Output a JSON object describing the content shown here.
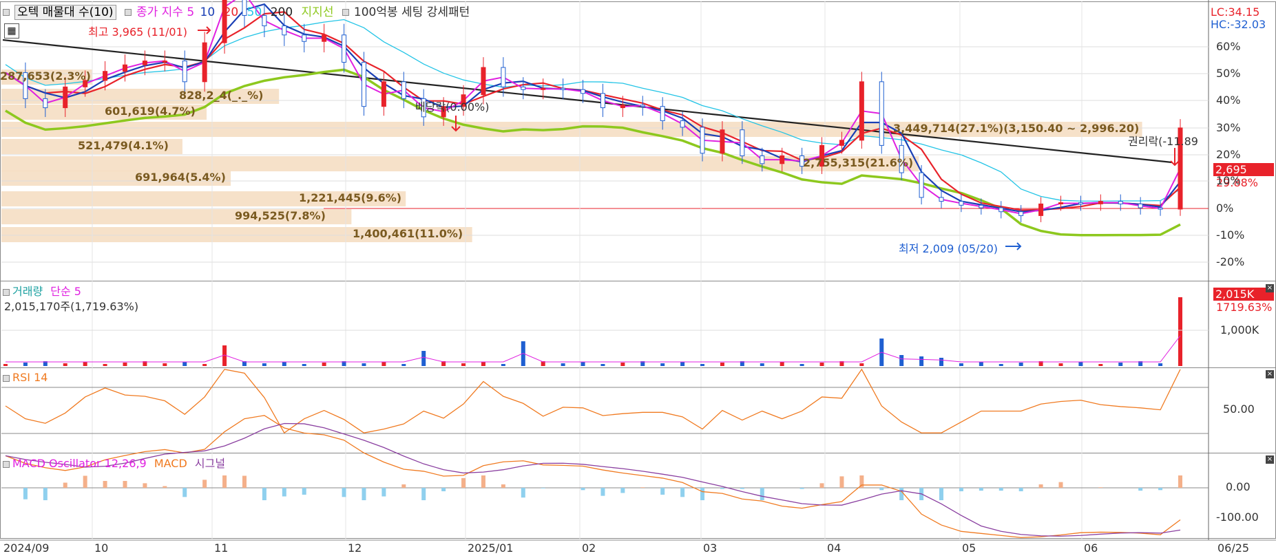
{
  "main_legend": {
    "stock_tab": "오텍 매물대 수(10)",
    "ma_label": "종가 지수 5",
    "ma10": "10",
    "ma20": "20",
    "ma50": "50",
    "ma200": "200",
    "support": "지지선",
    "pattern": "100억봉 세팅 강세패턴"
  },
  "top_right": {
    "lc": "LC:34.15",
    "hc": "HC:-32.03"
  },
  "annotations": {
    "high": "최고 3,965 (11/01)",
    "low": "최저 2,009 (05/20)",
    "dividend": "배당락(0.00%)",
    "rights": "권리락(-11.89",
    "price_tag": "2,695",
    "pct_tag": "29.88%"
  },
  "volume_profile": [
    {
      "label": "287,653(2.3%)"
    },
    {
      "label": "828,2_4(_._%)"
    },
    {
      "label": "601,619(4.7%)"
    },
    {
      "label": "521,479(4.1%)"
    },
    {
      "label": "691,964(5.4%)"
    },
    {
      "label": "1,221,445(9.6%)"
    },
    {
      "label": "994,525(7.8%)"
    },
    {
      "label": "1,400,461(11.0%)"
    },
    {
      "label": "2,755,315(21.6%)"
    },
    {
      "label": "3,449,714(27.1%)(3,150.40 ~ 2,996.20)"
    }
  ],
  "volume_panel": {
    "title": "거래량",
    "ma": "단순 5",
    "value": "2,015,170주(1,719.63%)",
    "tag": "2,015K",
    "tag_pct": "1719.63%",
    "axis": "1,000K"
  },
  "rsi_panel": {
    "title": "RSI 14",
    "axis": "50.00"
  },
  "macd_panel": {
    "title": "MACD Oscillator 12,26,9",
    "macd": "MACD",
    "signal": "시그널",
    "axis_top": "0.00",
    "axis_bottom": "-100.00"
  },
  "x_labels": [
    "2024/09",
    "10",
    "11",
    "12",
    "2025/01",
    "02",
    "03",
    "04",
    "05",
    "06",
    "06/25"
  ],
  "y_labels": [
    "60%",
    "50%",
    "40%",
    "30%",
    "20%",
    "10%",
    "0%",
    "-10%",
    "-20%"
  ],
  "chart_data": {
    "type": "line",
    "series": [
      {
        "name": "종가",
        "values": [
          3120,
          2920,
          2850,
          3010,
          3060,
          3130,
          3180,
          3210,
          3210,
          3050,
          3350,
          3900,
          3560,
          3480,
          3410,
          3360,
          3410,
          3200,
          2860,
          3050,
          2920,
          2780,
          2860,
          2950,
          3160,
          3010,
          2990,
          3000,
          2990,
          2960,
          2850,
          2870,
          2860,
          2750,
          2700,
          2500,
          2680,
          2480,
          2420,
          2480,
          2400,
          2560,
          2600,
          3050,
          2560,
          2350,
          2160,
          2130,
          2100,
          2080,
          2050,
          2020,
          2110,
          2120,
          2110,
          2130,
          2110,
          2080,
          2070,
          2695
        ]
      }
    ],
    "colors": {
      "ma5": "#e020e0",
      "ma10": "#1a3fb5",
      "ma20": "#e8222a",
      "ma50": "#22c4e6",
      "ma200": "#222222",
      "support": "#8dc81e",
      "up": "#e8222a",
      "down": "#1f5fd1"
    }
  }
}
